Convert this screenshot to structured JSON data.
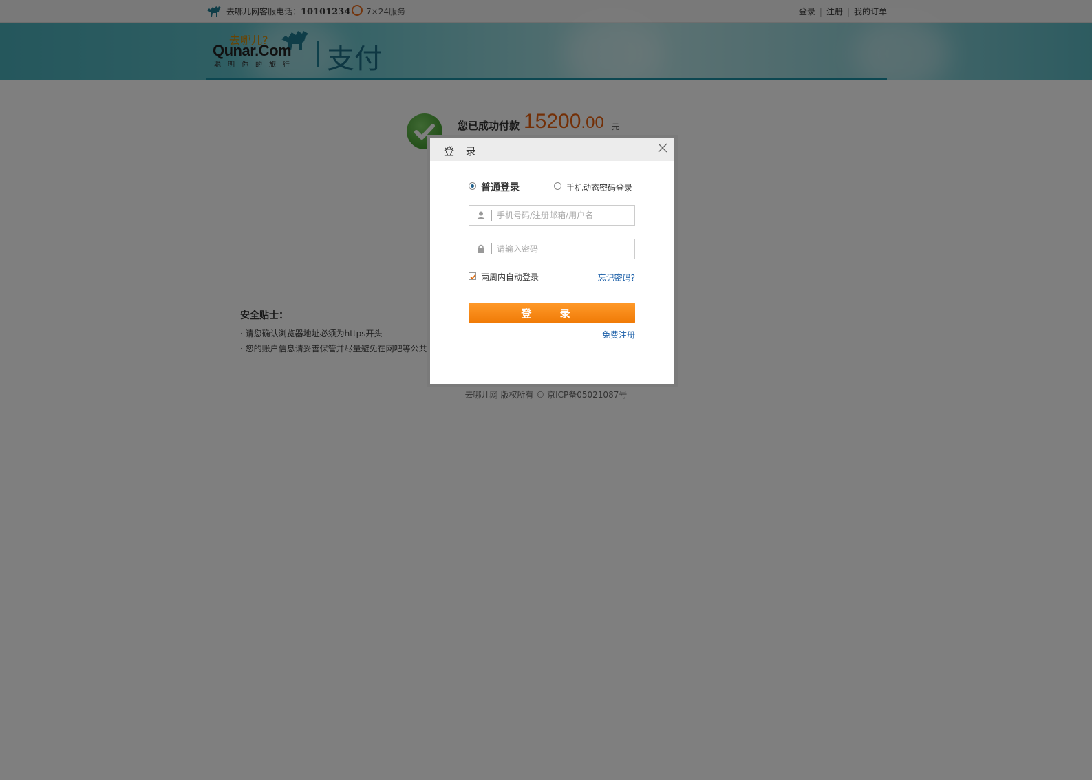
{
  "topbar": {
    "hotline_label": "去哪儿网客服电话：",
    "hotline_number": "10101234",
    "service_text": "7×24服务",
    "links": {
      "login": "登录",
      "register": "注册",
      "orders": "我的订单"
    }
  },
  "header": {
    "logo_cn": "去哪儿?",
    "logo_en": "Qunar.Com",
    "logo_slogan": "聪明你的旅行",
    "section_title": "支付"
  },
  "payment": {
    "success_label": "您已成功付款",
    "amount_int": "15200",
    "amount_dec": ".00",
    "unit": "元"
  },
  "tips": {
    "title": "安全贴士：",
    "items": [
      "· 请您确认浏览器地址必须为https开头",
      "· 您的账户信息请妥善保管并尽量避免在网吧等公共场"
    ]
  },
  "footer": {
    "copyright": "去哪儿网 版权所有 © 京ICP备05021087号"
  },
  "dialog": {
    "title": "登 录",
    "tab_normal": "普通登录",
    "tab_phone": "手机动态密码登录",
    "username_placeholder": "手机号码/注册邮箱/用户名",
    "password_placeholder": "请输入密码",
    "remember_label": "两周内自动登录",
    "forgot_link": "忘记密码?",
    "login_button": "登 录",
    "register_link": "免费注册"
  },
  "colors": {
    "accent_orange": "#f07a06",
    "amount_color": "#e75e0c",
    "link_blue": "#1b5fa8",
    "brand_teal": "#1c6f87"
  }
}
